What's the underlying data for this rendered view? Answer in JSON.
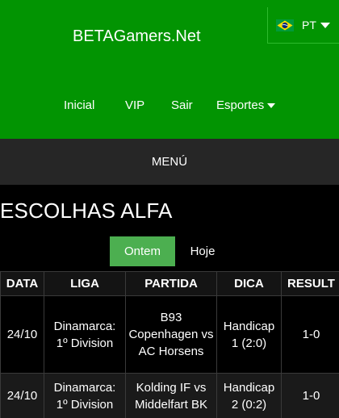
{
  "header": {
    "brand": "BETAGamers.Net",
    "language": {
      "code": "PT",
      "flag_icon": "brazil-flag-icon"
    },
    "nav": [
      {
        "label": "Inicial"
      },
      {
        "label": "VIP"
      },
      {
        "label": "Sair"
      },
      {
        "label": "Esportes",
        "has_dropdown": true
      }
    ]
  },
  "menu": {
    "label": "MENÚ"
  },
  "section": {
    "title": "ESCOLHAS ALFA"
  },
  "tabs": [
    {
      "label": "Ontem",
      "active": true
    },
    {
      "label": "Hoje",
      "active": false
    }
  ],
  "table": {
    "headers": [
      "DATA",
      "LIGA",
      "PARTIDA",
      "DICA",
      "RESULT"
    ],
    "rows": [
      {
        "data": "24/10",
        "liga": "Dinamarca: 1º Division",
        "partida": "B93 Copenhagen vs AC Horsens",
        "dica": "Handicap 1 (2:0)",
        "result": "1-0"
      },
      {
        "data": "24/10",
        "liga": "Dinamarca: 1º Division",
        "partida": "Kolding IF vs Middelfart BK",
        "dica": "Handicap 2 (0:2)",
        "result": "1-0"
      }
    ]
  },
  "colors": {
    "header_green": "#029402",
    "tab_active": "#4caf50",
    "menu_bar": "#262626",
    "background": "#000000"
  }
}
